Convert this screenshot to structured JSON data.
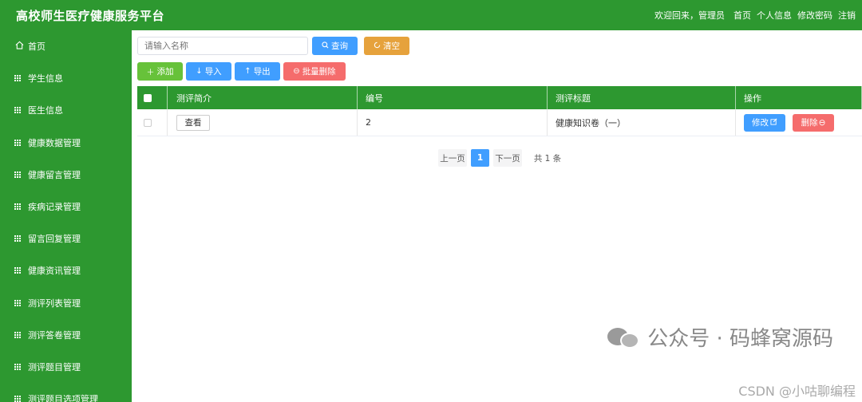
{
  "header": {
    "title": "高校师生医疗健康服务平台",
    "welcome": "欢迎回来，管理员",
    "links": [
      "首页",
      "个人信息",
      "修改密码",
      "注销"
    ]
  },
  "sidebar": {
    "home": "首页",
    "items": [
      "学生信息",
      "医生信息",
      "健康数据管理",
      "健康留言管理",
      "疾病记录管理",
      "留言回复管理",
      "健康资讯管理",
      "测评列表管理",
      "测评答卷管理",
      "测评题目管理",
      "测评题目选项管理"
    ]
  },
  "search": {
    "placeholder": "请输入名称",
    "query_label": "查询",
    "clear_label": "清空"
  },
  "toolbar": {
    "add_label": "添加",
    "import_label": "导入",
    "export_label": "导出",
    "batch_delete_label": "批量删除"
  },
  "table": {
    "columns": [
      "测评简介",
      "编号",
      "测评标题",
      "操作"
    ],
    "rows": [
      {
        "intro_button": "查看",
        "id": "2",
        "title": "健康知识卷（一）",
        "edit_label": "修改",
        "delete_label": "删除"
      }
    ]
  },
  "pagination": {
    "prev": "上一页",
    "current": "1",
    "next": "下一页",
    "total": "共 1 条"
  },
  "watermark": {
    "text": "公众号 · 码蜂窝源码",
    "credit": "CSDN @小咕聊编程"
  },
  "colors": {
    "primary_green": "#2d9830",
    "blue": "#409eff",
    "orange": "#e6a23c",
    "red": "#f56c6c",
    "light_green": "#67c23a"
  }
}
